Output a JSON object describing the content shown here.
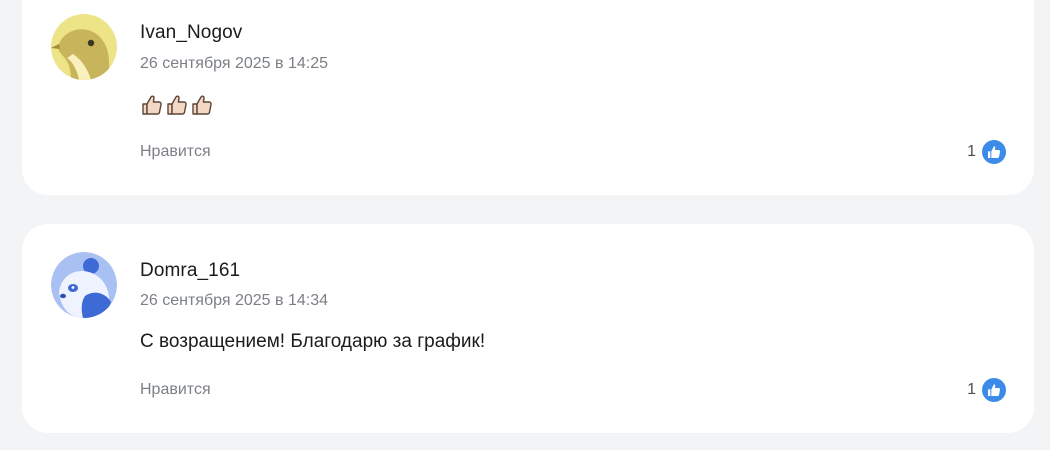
{
  "comments": [
    {
      "author": "Ivan_Nogov",
      "date": "26 сентября 2025 в 14:25",
      "body_emoji": [
        "thumbs-up",
        "thumbs-up",
        "thumbs-up"
      ],
      "like_label": "Нравится",
      "like_count": "1",
      "avatar_color": "#ece486"
    },
    {
      "author": "Domra_161",
      "date": "26 сентября 2025 в 14:34",
      "body": "С возращением! Благодарю за график!",
      "like_label": "Нравится",
      "like_count": "1",
      "avatar_color": "#a9c0f2"
    }
  ],
  "colors": {
    "background": "#f3f4f6",
    "card": "#ffffff",
    "like_accent": "#3d8be8",
    "muted_text": "#7b7f86"
  }
}
